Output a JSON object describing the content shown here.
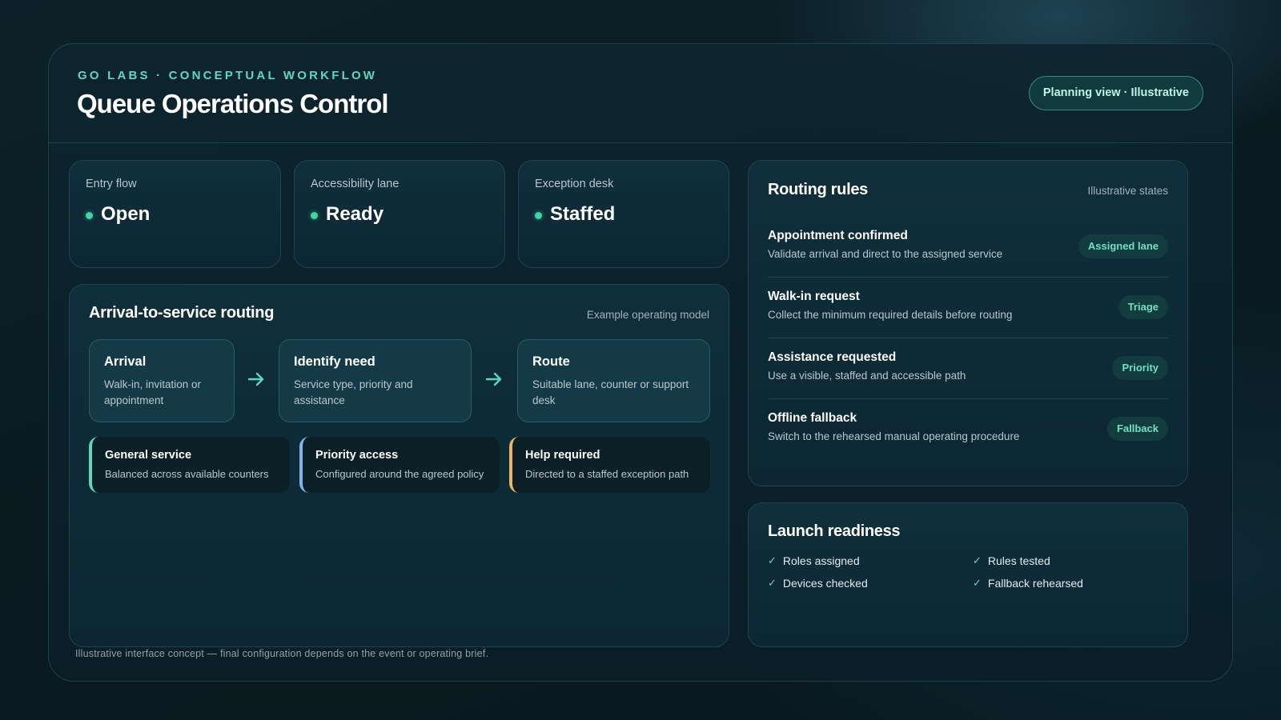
{
  "header": {
    "eyebrow": "GO LABS · CONCEPTUAL WORKFLOW",
    "title": "Queue Operations Control",
    "badge": "Planning view · Illustrative"
  },
  "stats": [
    {
      "label": "Entry flow",
      "value": "Open"
    },
    {
      "label": "Accessibility lane",
      "value": "Ready"
    },
    {
      "label": "Exception desk",
      "value": "Staffed"
    }
  ],
  "routing": {
    "title": "Arrival-to-service routing",
    "note": "Example operating model",
    "steps": [
      {
        "title": "Arrival",
        "desc": "Walk-in, invitation or appointment"
      },
      {
        "title": "Identify need",
        "desc": "Service type, priority and assistance"
      },
      {
        "title": "Route",
        "desc": "Suitable lane, counter or support desk"
      }
    ],
    "lanes": [
      {
        "title": "General service",
        "desc": "Balanced across available counters"
      },
      {
        "title": "Priority access",
        "desc": "Configured around the agreed policy"
      },
      {
        "title": "Help required",
        "desc": "Directed to a staffed exception path"
      }
    ]
  },
  "rules": {
    "title": "Routing rules",
    "note": "Illustrative states",
    "items": [
      {
        "title": "Appointment confirmed",
        "desc": "Validate arrival and direct to the assigned service",
        "tag": "Assigned lane"
      },
      {
        "title": "Walk-in request",
        "desc": "Collect the minimum required details before routing",
        "tag": "Triage"
      },
      {
        "title": "Assistance requested",
        "desc": "Use a visible, staffed and accessible path",
        "tag": "Priority"
      },
      {
        "title": "Offline fallback",
        "desc": "Switch to the rehearsed manual operating procedure",
        "tag": "Fallback"
      }
    ]
  },
  "readiness": {
    "title": "Launch readiness",
    "items": [
      "Roles assigned",
      "Rules tested",
      "Devices checked",
      "Fallback rehearsed"
    ]
  },
  "footer": "Illustrative interface concept — final configuration depends on the event or operating brief.",
  "colors": {
    "accent": "#5fd6bd",
    "status_dot": "#45d3a3",
    "lane_general": "#5fd6bd",
    "lane_priority": "#7fb6e8",
    "lane_help": "#e8b56a"
  }
}
